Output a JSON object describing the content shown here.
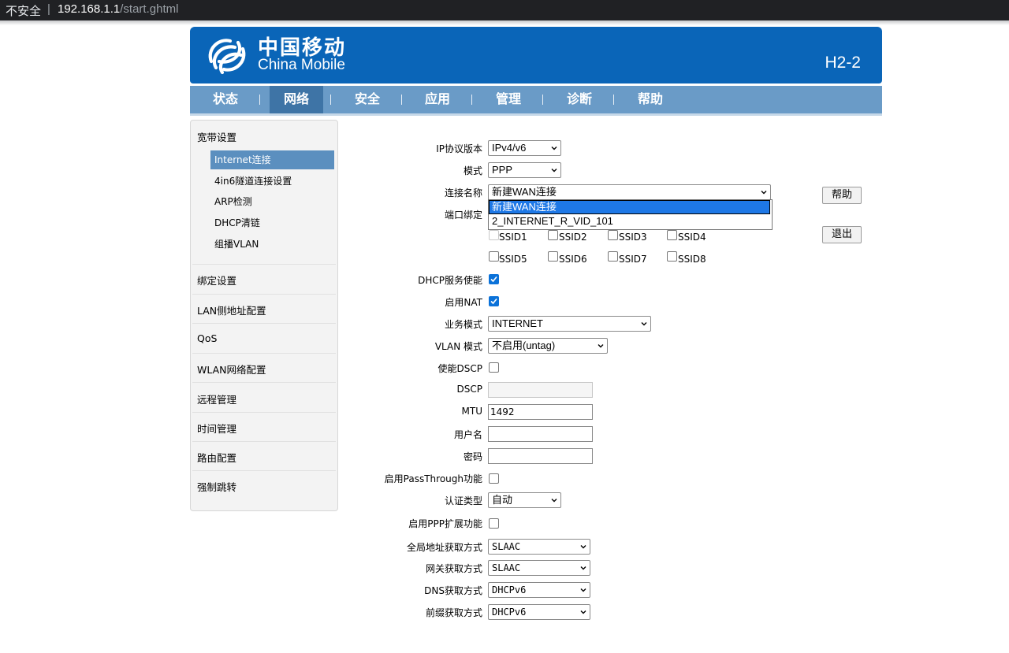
{
  "browser": {
    "security": "不安全",
    "host": "192.168.1.1",
    "path": "/start.ghtml"
  },
  "header": {
    "brand_cn": "中国移动",
    "brand_en": "China Mobile",
    "model": "H2-2"
  },
  "nav": {
    "items": [
      "状态",
      "网络",
      "安全",
      "应用",
      "管理",
      "诊断",
      "帮助"
    ],
    "active": "网络"
  },
  "sidebar": {
    "group1": "宽带设置",
    "sub": [
      "Internet连接",
      "4in6隧道连接设置",
      "ARP检测",
      "DHCP清链",
      "组播VLAN"
    ],
    "items": [
      "绑定设置",
      "LAN侧地址配置",
      "QoS",
      "WLAN网络配置",
      "远程管理",
      "时间管理",
      "路由配置",
      "强制跳转"
    ]
  },
  "form": {
    "ip_version": {
      "label": "IP协议版本",
      "value": "IPv4/v6"
    },
    "mode": {
      "label": "模式",
      "value": "PPP"
    },
    "conn_name": {
      "label": "连接名称",
      "value": "新建WAN连接",
      "options": [
        "新建WAN连接",
        "2_INTERNET_R_VID_101"
      ]
    },
    "port_bind": {
      "label": "端口绑定",
      "ssids": [
        "SSID1",
        "SSID2",
        "SSID3",
        "SSID4",
        "SSID5",
        "SSID6",
        "SSID7",
        "SSID8"
      ]
    },
    "dhcp": {
      "label": "DHCP服务使能"
    },
    "nat": {
      "label": "启用NAT"
    },
    "service_mode": {
      "label": "业务模式",
      "value": "INTERNET"
    },
    "vlan_mode": {
      "label": "VLAN 模式",
      "value": "不启用(untag)"
    },
    "dscp_enable": {
      "label": "使能DSCP"
    },
    "dscp": {
      "label": "DSCP",
      "value": ""
    },
    "mtu": {
      "label": "MTU",
      "value": "1492"
    },
    "username": {
      "label": "用户名",
      "value": ""
    },
    "password": {
      "label": "密码",
      "value": ""
    },
    "passthrough": {
      "label": "启用PassThrough功能"
    },
    "auth_type": {
      "label": "认证类型",
      "value": "自动"
    },
    "ppp_ext": {
      "label": "启用PPP扩展功能"
    },
    "global_addr": {
      "label": "全局地址获取方式",
      "value": "SLAAC"
    },
    "gateway": {
      "label": "网关获取方式",
      "value": "SLAAC"
    },
    "dns": {
      "label": "DNS获取方式",
      "value": "DHCPv6"
    },
    "prefix": {
      "label": "前缀获取方式",
      "value": "DHCPv6"
    }
  },
  "buttons": {
    "help": "帮助",
    "logout": "退出"
  },
  "colors": {
    "header": "#0a65b8",
    "nav": "#6a9bc7",
    "nav_active": "#3e74a6",
    "sidebar_active": "#5b8fbf",
    "check": "#0b72d9"
  }
}
